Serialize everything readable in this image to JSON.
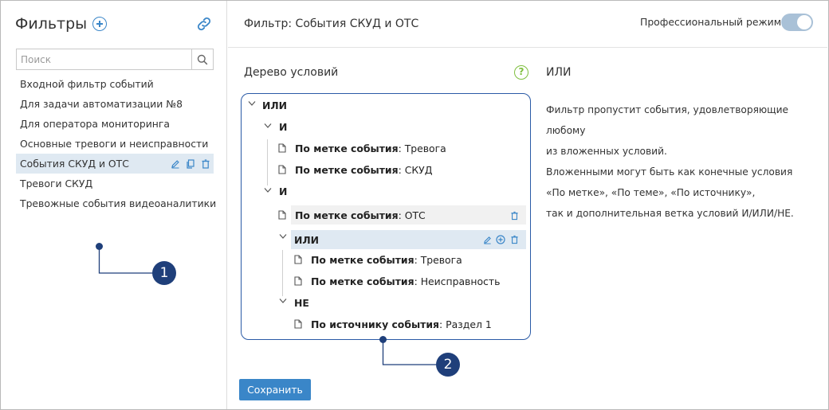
{
  "sidebar": {
    "title": "Фильтры",
    "search_placeholder": "Поиск",
    "items": [
      {
        "label": "Входной фильтр событий"
      },
      {
        "label": "Для задачи автоматизации №8"
      },
      {
        "label": "Для оператора мониторинга"
      },
      {
        "label": "Основные тревоги и неисправности"
      },
      {
        "label": "События СКУД и ОТС"
      },
      {
        "label": "Тревоги СКУД"
      },
      {
        "label": "Тревожные события видеоаналитики"
      }
    ],
    "selected_index": 4
  },
  "main": {
    "title": "Фильтр: События СКУД и ОТС",
    "pro_mode_label": "Профессиональный режим",
    "pro_mode_on": true,
    "tree_label": "Дерево условий",
    "save_label": "Сохранить"
  },
  "tree": {
    "n0": {
      "label": "ИЛИ"
    },
    "n1": {
      "label": "И"
    },
    "n2": {
      "key": "По метке события",
      "value": ": Тревога"
    },
    "n3": {
      "key": "По метке события",
      "value": ": СКУД"
    },
    "n4": {
      "label": "И"
    },
    "n5": {
      "key": "По метке события",
      "value": ": ОТС"
    },
    "n6": {
      "label": "ИЛИ"
    },
    "n7": {
      "key": "По метке события",
      "value": ": Тревога"
    },
    "n8": {
      "key": "По метке события",
      "value": ": Неисправность"
    },
    "n9": {
      "label": "НЕ"
    },
    "n10": {
      "key": "По источнику события",
      "value": ": Раздел 1"
    }
  },
  "description": {
    "title": "ИЛИ",
    "lines": [
      "Фильтр пропустит события, удовлетворяющие любому",
      "из вложенных условий.",
      "Вложенными могут быть как конечные условия",
      "«По метке», «По теме», «По источнику»,",
      "так и дополнительная ветка условий И/ИЛИ/НЕ."
    ]
  },
  "callouts": {
    "c1": "1",
    "c2": "2"
  },
  "colors": {
    "accent": "#3a86c8",
    "callout": "#1f3f7a",
    "selection": "#dfe9f2",
    "help": "#7fbf3f"
  }
}
